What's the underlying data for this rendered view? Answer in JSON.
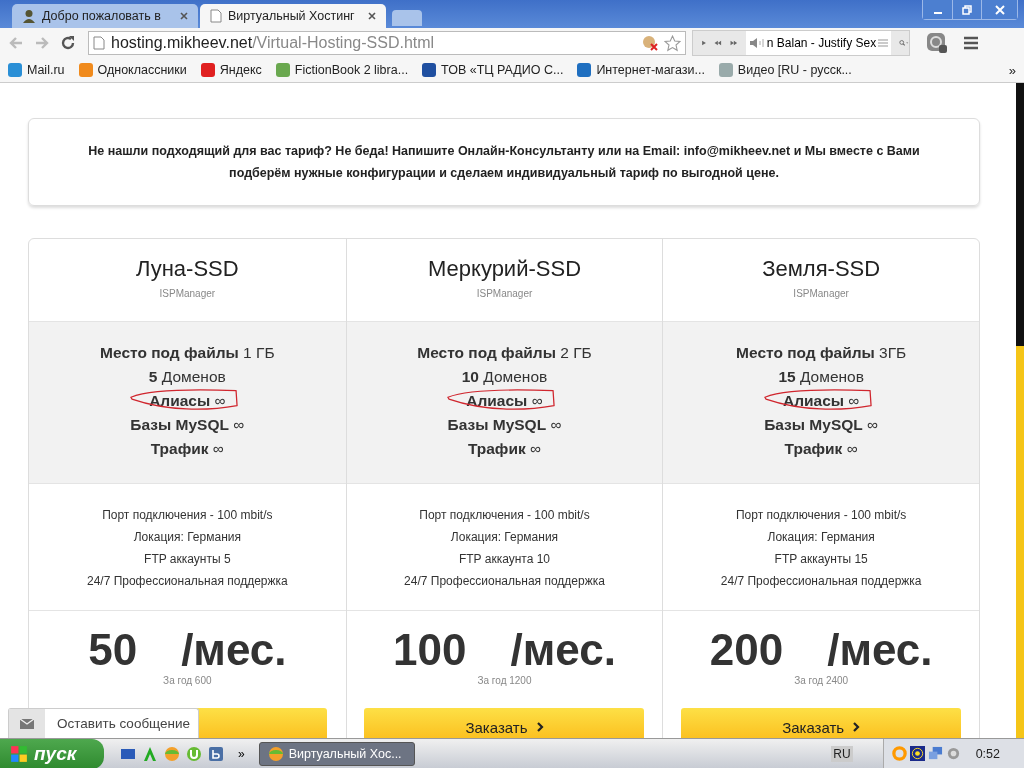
{
  "browser": {
    "tabs": [
      {
        "title": "Добро пожаловать в",
        "selected": false
      },
      {
        "title": "Виртуальный Хостинг",
        "selected": true
      }
    ],
    "address": {
      "host": "hosting.mikheev.net",
      "path": "/Virtual-Hosting-SSD.html"
    },
    "player": {
      "track": "n Balan - Justify Sex"
    },
    "bookmarks": [
      {
        "label": "Mail.ru"
      },
      {
        "label": "Одноклассники"
      },
      {
        "label": "Яндекс"
      },
      {
        "label": "FictionBook 2 libra..."
      },
      {
        "label": "ТОВ «ТЦ РАДИО С..."
      },
      {
        "label": "Интернет-магази..."
      },
      {
        "label": "Видео [RU - русск..."
      }
    ],
    "bookmarks_more": "»"
  },
  "notice": "**Не нашли подходящий для вас тариф? Не беда! Напишите Онлайн-Консультанту или на Email: info@mikheev.net и Мы вместе с Вами подберём нужные конфигурации и сделаем индивидуальный тариф по выгодной цене.**",
  "plans": [
    {
      "name": "Луна-SSD",
      "panel": "ISPManager",
      "features": [
        {
          "text": "**Место под файлы** 1 ГБ",
          "circled": false
        },
        {
          "text": "**5** Доменов",
          "circled": false
        },
        {
          "text": "**Алиасы** ∞",
          "circled": true
        },
        {
          "text": "**Базы MySQL** ∞",
          "circled": false
        },
        {
          "text": "**Трафик** ∞",
          "circled": false
        }
      ],
      "specs": [
        "Порт подключения - 100 mbit/s",
        "Локация: Германия",
        "FTP аккаунты 5",
        "24/7 Профессиональная поддержка"
      ],
      "price": "50",
      "per": "/мес.",
      "yearly": "За год 600"
    },
    {
      "name": "Меркурий-SSD",
      "panel": "ISPManager",
      "features": [
        {
          "text": "**Место под файлы** 2 ГБ",
          "circled": false
        },
        {
          "text": "**10** Доменов",
          "circled": false
        },
        {
          "text": "**Алиасы** ∞",
          "circled": true
        },
        {
          "text": "**Базы MySQL** ∞",
          "circled": false
        },
        {
          "text": "**Трафик** ∞",
          "circled": false
        }
      ],
      "specs": [
        "Порт подключения - 100 mbit/s",
        "Локация: Германия",
        "FTP аккаунта 10",
        "24/7 Профессиональная поддержка"
      ],
      "price": "100",
      "per": "/мес.",
      "yearly": "За год 1200",
      "button": "Заказать"
    },
    {
      "name": "Земля-SSD",
      "panel": "ISPManager",
      "features": [
        {
          "text": "**Место под файлы** 3ГБ",
          "circled": false
        },
        {
          "text": "**15** Доменов",
          "circled": false
        },
        {
          "text": "**Алиасы** ∞",
          "circled": true
        },
        {
          "text": "**Базы MySQL** ∞",
          "circled": false
        },
        {
          "text": "**Трафик** ∞",
          "circled": false
        }
      ],
      "specs": [
        "Порт подключения - 100 mbit/s",
        "Локация: Германия",
        "FTP аккаунты 15",
        "24/7 Профессиональная поддержка"
      ],
      "price": "200",
      "per": "/мес.",
      "yearly": "За год 2400",
      "button": "Заказать"
    }
  ],
  "chat_widget": {
    "label": "Оставить сообщение"
  },
  "taskbar": {
    "start": "пуск",
    "more": "»",
    "tasks": [
      {
        "title": "Виртуальный Хос...",
        "selected": true
      }
    ],
    "language": "RU",
    "clock": "0:52"
  }
}
